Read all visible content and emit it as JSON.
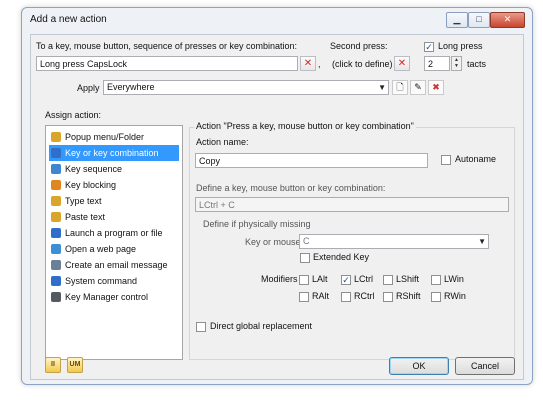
{
  "window": {
    "title": "Add a new action",
    "controls": {
      "minimize": "▁",
      "maximize": "□",
      "close": "✕"
    }
  },
  "top": {
    "key_label": "To a key, mouse button, sequence of presses or key combination:",
    "key_value": "Long press CapsLock",
    "comma": ",",
    "second_label": "Second press:",
    "second_value": "(click to define)",
    "long_press_label": "Long press",
    "long_press_checked": true,
    "tacts_value": "2",
    "tacts_label": "tacts",
    "apply_label": "Apply",
    "apply_value": "Everywhere"
  },
  "assign": {
    "label": "Assign action:",
    "items": [
      {
        "label": "Popup menu/Folder",
        "icon": "folder-menu-icon",
        "color": "#d9a62a",
        "selected": false
      },
      {
        "label": "Key or key combination",
        "icon": "key-icon",
        "color": "#2f6fc9",
        "selected": true
      },
      {
        "label": "Key sequence",
        "icon": "key-sequence-icon",
        "color": "#3f86d1",
        "selected": false
      },
      {
        "label": "Key blocking",
        "icon": "key-blocking-icon",
        "color": "#e0861e",
        "selected": false
      },
      {
        "label": "Type text",
        "icon": "type-text-icon",
        "color": "#d9a62a",
        "selected": false
      },
      {
        "label": "Paste text",
        "icon": "paste-text-icon",
        "color": "#d9a62a",
        "selected": false
      },
      {
        "label": "Launch a program or file",
        "icon": "launch-program-icon",
        "color": "#2f6fc9",
        "selected": false
      },
      {
        "label": "Open a web page",
        "icon": "globe-icon",
        "color": "#3a8fd6",
        "selected": false
      },
      {
        "label": "Create an email message",
        "icon": "email-icon",
        "color": "#6b7f99",
        "selected": false
      },
      {
        "label": "System command",
        "icon": "system-command-icon",
        "color": "#2f6fc9",
        "selected": false
      },
      {
        "label": "Key Manager control",
        "icon": "key-manager-icon",
        "color": "#555a60",
        "selected": false
      }
    ]
  },
  "action": {
    "group_title": "Action \"Press a key, mouse button or key combination\"",
    "name_label": "Action name:",
    "name_value": "Copy",
    "autoname_label": "Autoname",
    "define_label": "Define a key, mouse button or key combination:",
    "define_value": "LCtrl + C",
    "physically_missing_label": "Define if physically missing",
    "key_mouse_label": "Key or mouse button",
    "key_mouse_value": "C",
    "extended_key_label": "Extended Key",
    "modifiers_label": "Modifiers",
    "modifiers": [
      {
        "label": "LAlt",
        "checked": false
      },
      {
        "label": "LCtrl",
        "checked": true
      },
      {
        "label": "LShift",
        "checked": false
      },
      {
        "label": "LWin",
        "checked": false
      },
      {
        "label": "RAlt",
        "checked": false
      },
      {
        "label": "RCtrl",
        "checked": false
      },
      {
        "label": "RShift",
        "checked": false
      },
      {
        "label": "RWin",
        "checked": false
      }
    ],
    "direct_label": "Direct global replacement"
  },
  "bottom": {
    "ok_label": "OK",
    "cancel_label": "Cancel",
    "pause_icon_text": "II",
    "um_icon_text": "UM"
  },
  "checkmark": "✓",
  "colors": {
    "selection": "#3399ff",
    "clear_x": "#dd2222"
  }
}
